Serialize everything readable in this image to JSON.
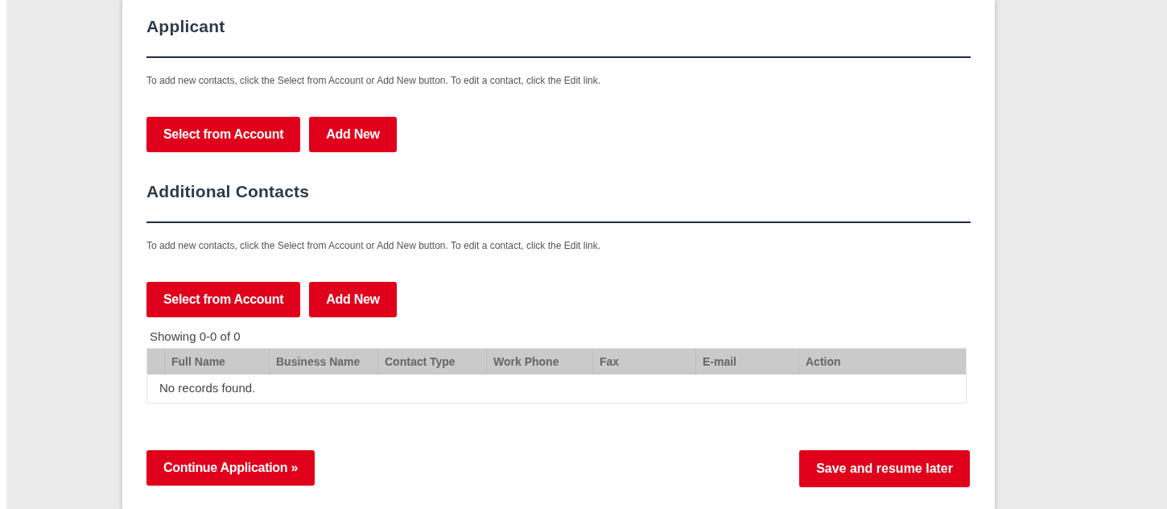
{
  "sections": [
    {
      "title": "Applicant",
      "instructions": "To add new contacts, click the Select from Account or Add New button. To edit a contact, click the Edit link.",
      "buttons": [
        "Select from Account",
        "Add New"
      ]
    },
    {
      "title": "Additional Contacts",
      "instructions": "To add new contacts, click the Select from Account or Add New button. To edit a contact, click the Edit link.",
      "buttons": [
        "Select from Account",
        "Add New"
      ],
      "table": {
        "summary": "Showing 0-0 of 0",
        "columns": [
          "Full Name",
          "Business Name",
          "Contact Type",
          "Work Phone",
          "Fax",
          "E-mail",
          "Action"
        ],
        "empty_message": "No records found."
      }
    }
  ],
  "footer_buttons": [
    "Continue Application »",
    "Save and resume later"
  ]
}
